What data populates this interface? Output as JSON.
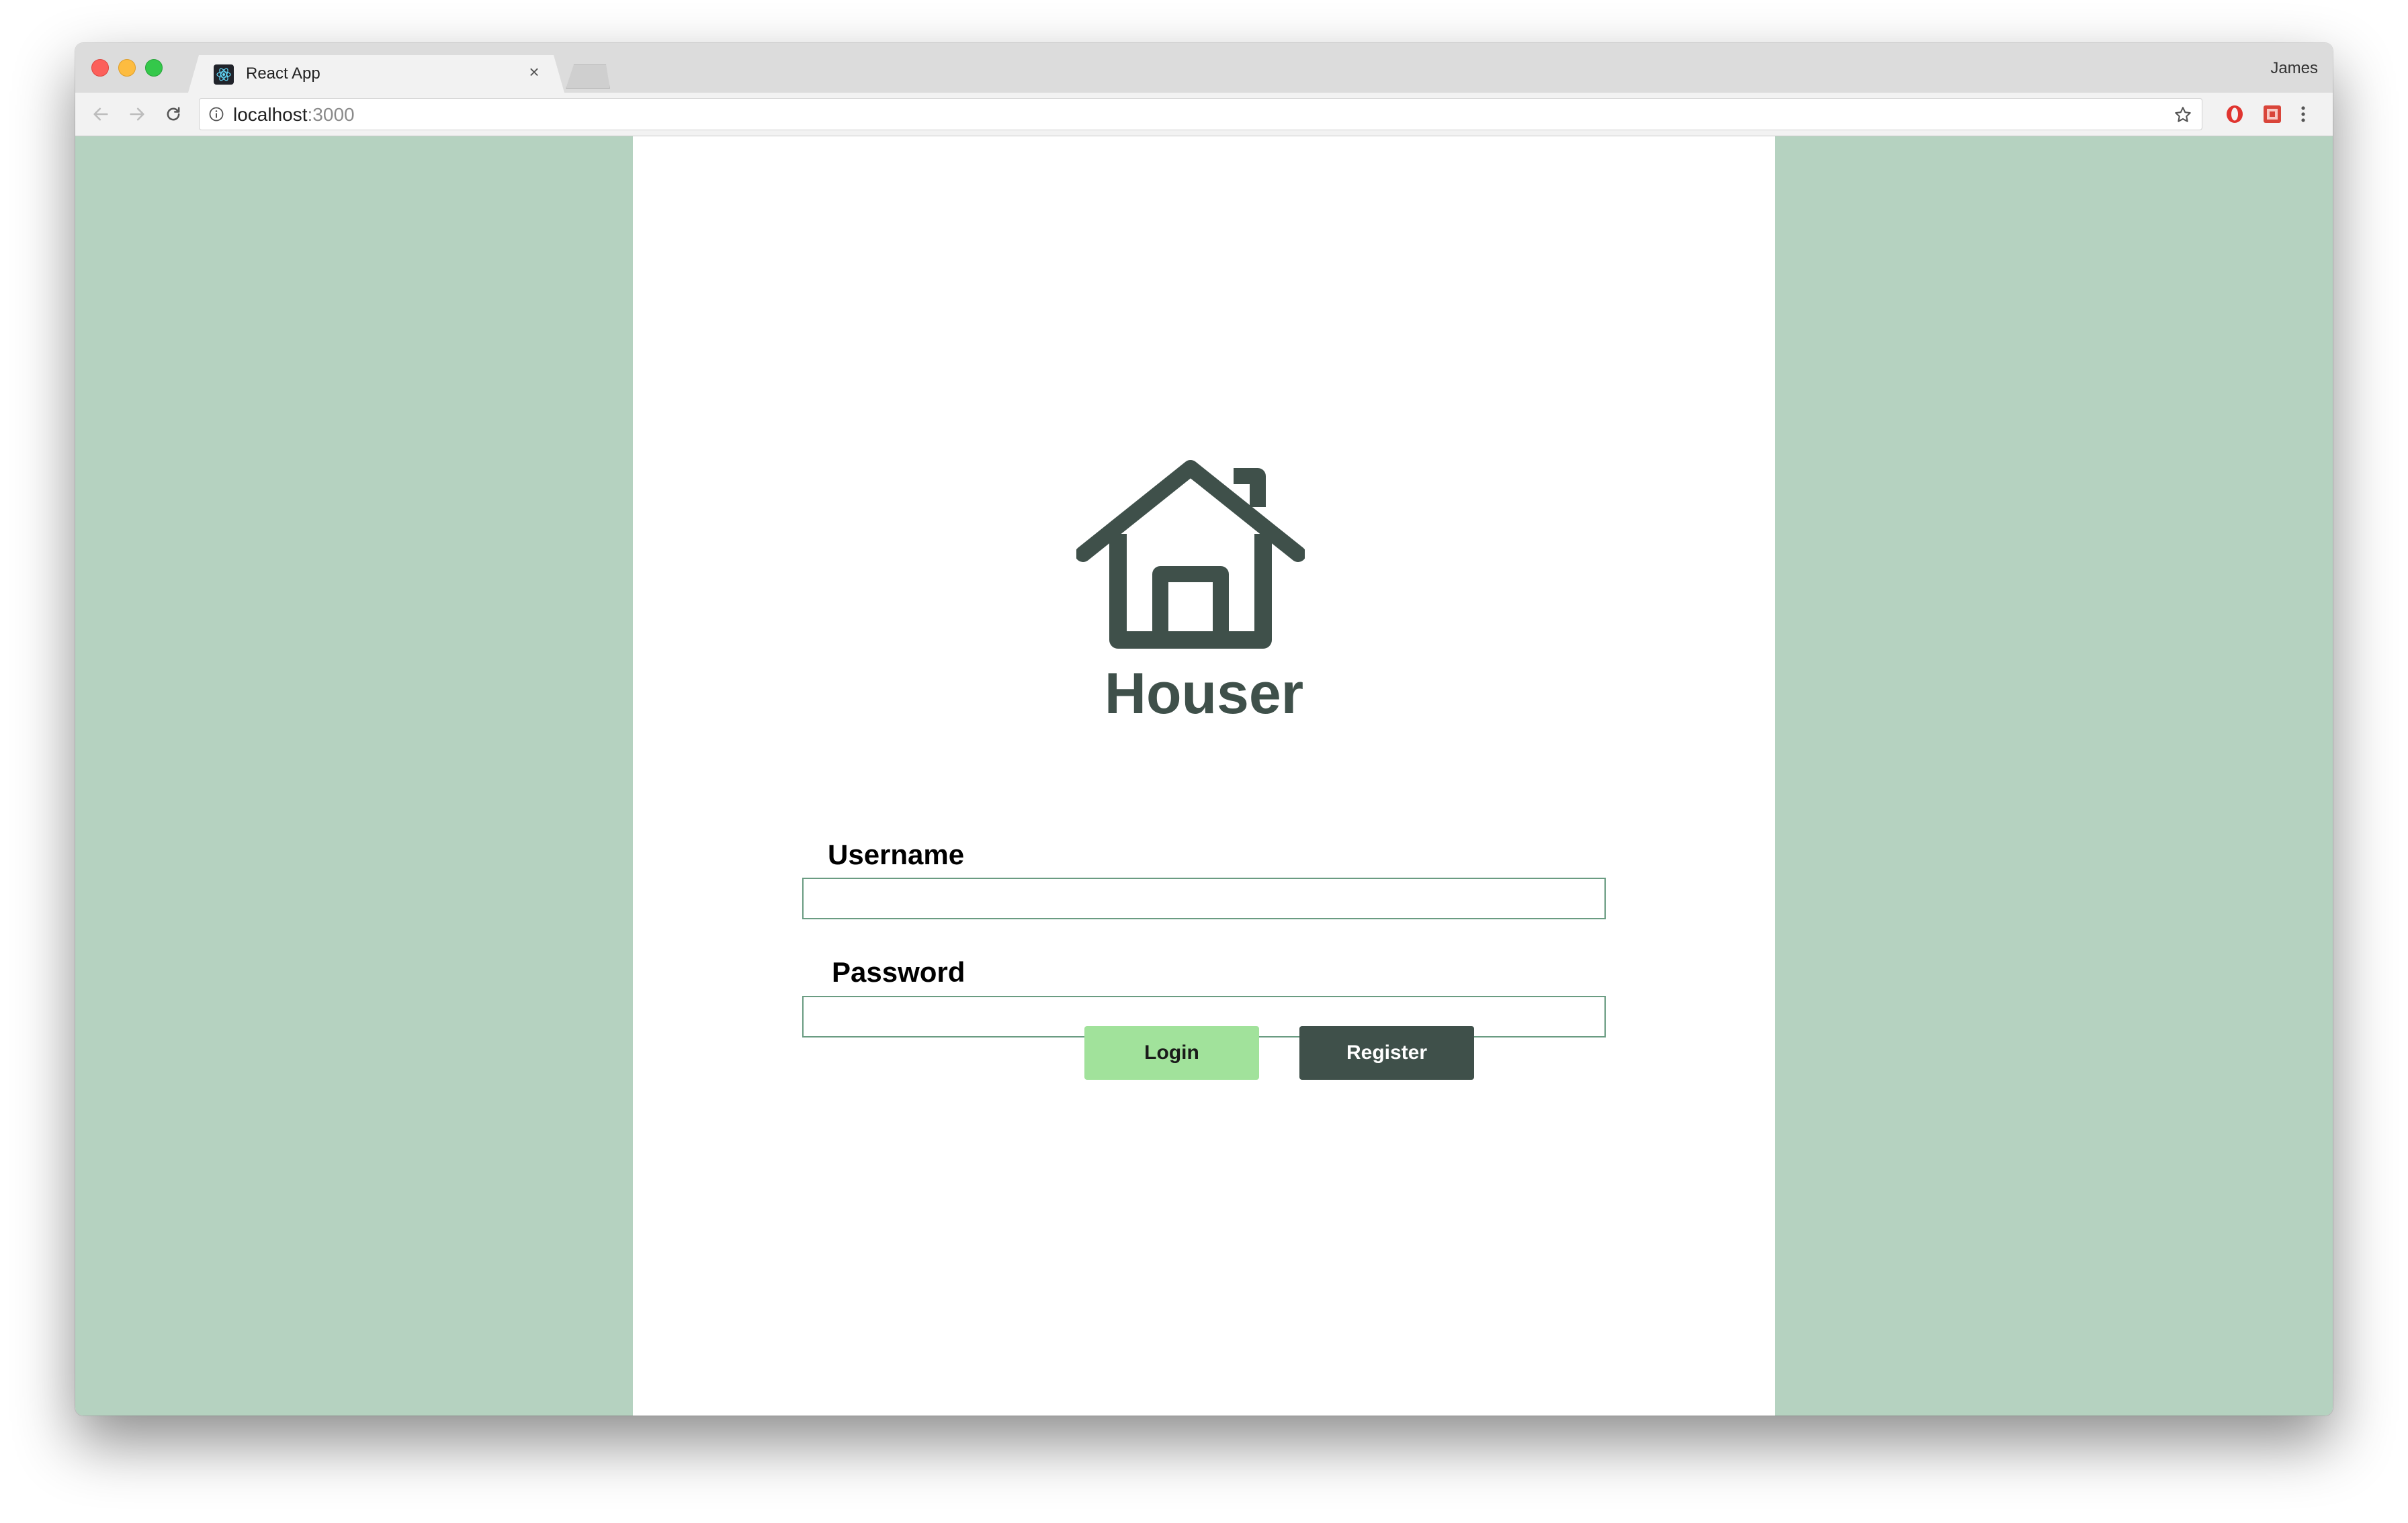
{
  "browser": {
    "tab_title": "React App",
    "tab_close": "×",
    "profile_name": "James",
    "url_host": "localhost",
    "url_port": ":3000"
  },
  "app": {
    "logo_title": "Houser",
    "username_label": "Username",
    "username_value": "",
    "password_label": "Password",
    "password_value": "",
    "login_label": "Login",
    "register_label": "Register"
  },
  "colors": {
    "side_background": "#b5d2c0",
    "panel_background": "#ffffff",
    "logo_color": "#3f504a",
    "login_button": "#a1e29b",
    "register_button": "#3f504a",
    "input_border": "#6a9c82"
  },
  "icons": {
    "logo": "house-icon",
    "favicon": "react-icon",
    "back": "back-arrow-icon",
    "forward": "forward-arrow-icon",
    "reload": "reload-icon",
    "site_info": "info-icon",
    "bookmark": "star-icon",
    "extension_1": "opera-icon",
    "extension_2": "extension-icon",
    "menu": "kebab-menu-icon"
  }
}
